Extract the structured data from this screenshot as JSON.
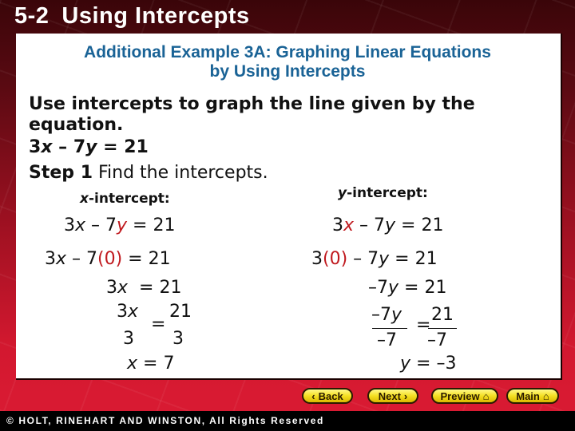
{
  "header": {
    "section": "5-2",
    "title": "Using Intercepts"
  },
  "panel": {
    "subtitle_line1": "Additional Example 3A: Graphing Linear Equations",
    "subtitle_line2": "by Using Intercepts",
    "prompt_line1": "Use intercepts to graph the line given by the",
    "prompt_line2": "equation.",
    "equation": {
      "a": "3",
      "x": "x",
      "mid": " – 7",
      "y": "y",
      "rhs": " = 21"
    },
    "step_label": "Step 1",
    "step_text": " Find the intercepts.",
    "x_intercept": {
      "label_var": "x",
      "label": "-intercept:",
      "line1": {
        "pre": "3",
        "x": "x",
        "mid": " – 7",
        "y": "y",
        "post": " = 21"
      },
      "line2": {
        "pre": "3",
        "x": "x",
        "mid": " – 7",
        "sub": "(0)",
        "post": " = 21"
      },
      "line3": {
        "pre": "3",
        "x": "x",
        "post": "  = 21"
      },
      "frac_left_num_pre": "3",
      "frac_left_num_var": "x",
      "frac_left_den": "3",
      "frac_eq": "=",
      "frac_right_num": "21",
      "frac_right_den": "3",
      "result_var": "x",
      "result": " = 7"
    },
    "y_intercept": {
      "label_var": "y",
      "label": "-intercept:",
      "line1": {
        "pre": "3",
        "x": "x",
        "mid": " – 7",
        "y": "y",
        "post": " = 21"
      },
      "line2": {
        "pre": "3",
        "sub": "(0)",
        "mid": " – 7",
        "y": "y",
        "post": " = 21"
      },
      "line3": {
        "pre": "–7",
        "y": "y",
        "post": " = 21"
      },
      "frac_left_num_pre": "–7",
      "frac_left_num_var": "y",
      "frac_left_den": "–7",
      "frac_eq": "=",
      "frac_right_num": "21",
      "frac_right_den": "–7",
      "result_var": "y",
      "result": " = –3"
    }
  },
  "nav": {
    "back": "Back",
    "back_icon": "‹",
    "next": "Next",
    "next_icon": "›",
    "preview": "Preview",
    "main": "Main",
    "home_icon": "⌂"
  },
  "footer": {
    "copyright": "© HOLT, RINEHART AND WINSTON, All Rights Reserved"
  },
  "colors": {
    "title_bar": "#3a0509",
    "background_red": "#d2182f",
    "subtitle": "#1a6396",
    "highlight": "#c0191e",
    "button": "#f4df22"
  }
}
